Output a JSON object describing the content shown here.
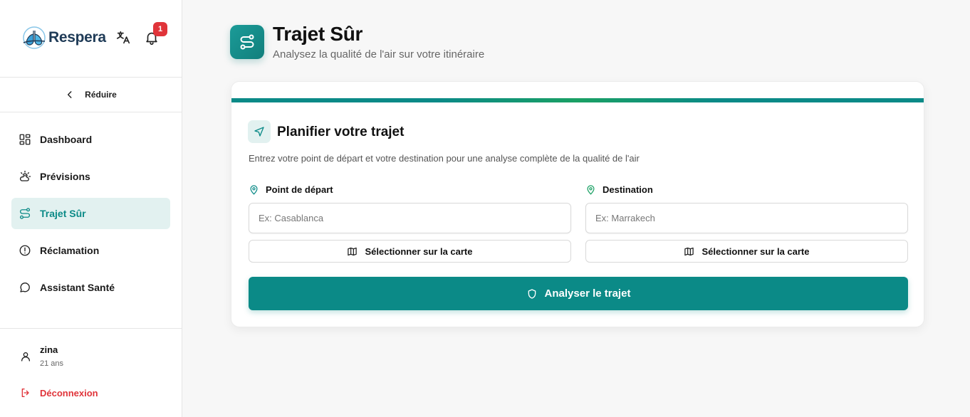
{
  "brand": {
    "name": "Respera",
    "notification_count": "1"
  },
  "sidebar": {
    "collapse_label": "Réduire",
    "items": [
      {
        "label": "Dashboard",
        "icon": "dashboard-icon",
        "active": false
      },
      {
        "label": "Prévisions",
        "icon": "weather-icon",
        "active": false
      },
      {
        "label": "Trajet Sûr",
        "icon": "route-icon",
        "active": true
      },
      {
        "label": "Réclamation",
        "icon": "alert-circle-icon",
        "active": false
      },
      {
        "label": "Assistant Santé",
        "icon": "chat-icon",
        "active": false
      }
    ],
    "user": {
      "name": "zina",
      "age": "21 ans"
    },
    "logout_label": "Déconnexion"
  },
  "header": {
    "title": "Trajet Sûr",
    "subtitle": "Analysez la qualité de l'air sur votre itinéraire"
  },
  "planner": {
    "title": "Planifier votre trajet",
    "description": "Entrez votre point de départ et votre destination pour une analyse complète de la qualité de l'air",
    "start": {
      "label": "Point de départ",
      "placeholder": "Ex: Casablanca",
      "map_button": "Sélectionner sur la carte"
    },
    "destination": {
      "label": "Destination",
      "placeholder": "Ex: Marrakech",
      "map_button": "Sélectionner sur la carte"
    },
    "analyze_button": "Analyser le trajet"
  },
  "colors": {
    "accent": "#0b8a87",
    "danger": "#e0343a",
    "active_bg": "#e2f1f0",
    "pin_green": "#1aa064"
  }
}
